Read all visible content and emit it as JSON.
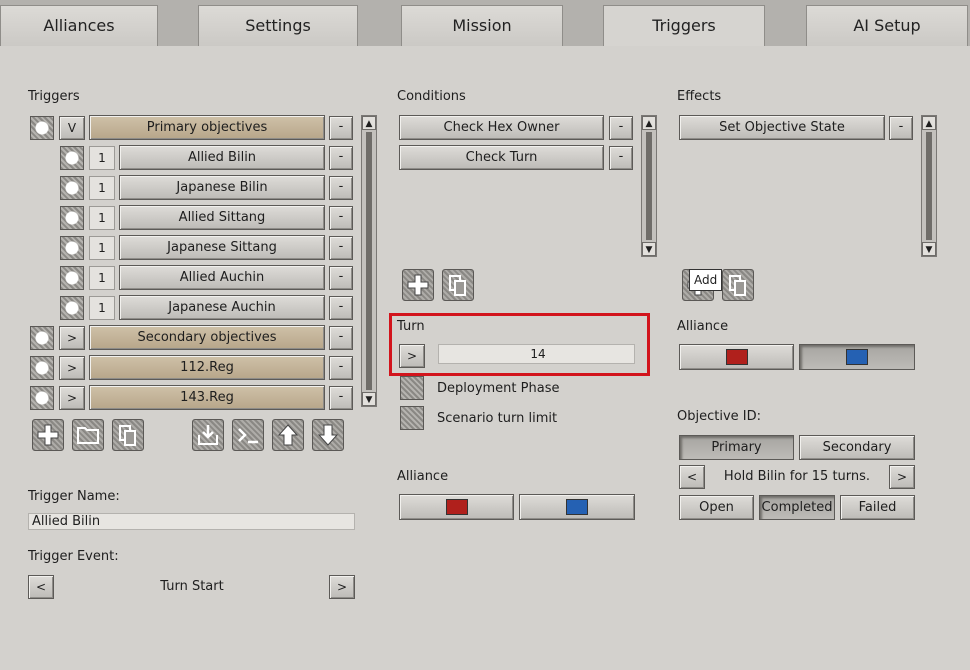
{
  "tabs": [
    "Alliances",
    "Settings",
    "Mission",
    "Triggers",
    "AI Setup"
  ],
  "triggers": {
    "heading": "Triggers",
    "rows": [
      {
        "toggle": "V",
        "label": "Primary objectives",
        "del": "-"
      },
      {
        "num": "1",
        "label": "Allied Bilin",
        "del": "-"
      },
      {
        "num": "1",
        "label": "Japanese Bilin",
        "del": "-"
      },
      {
        "num": "1",
        "label": "Allied Sittang",
        "del": "-"
      },
      {
        "num": "1",
        "label": "Japanese Sittang",
        "del": "-"
      },
      {
        "num": "1",
        "label": "Allied Auchin",
        "del": "-"
      },
      {
        "num": "1",
        "label": "Japanese Auchin",
        "del": "-"
      },
      {
        "toggle": ">",
        "label": "Secondary objectives",
        "del": "-"
      },
      {
        "toggle": ">",
        "label": "112.Reg",
        "del": "-"
      },
      {
        "toggle": ">",
        "label": "143.Reg",
        "del": "-"
      }
    ]
  },
  "trigger_name": {
    "label": "Trigger Name:",
    "value": "Allied Bilin"
  },
  "trigger_event": {
    "label": "Trigger Event:",
    "value": "Turn Start",
    "prev": "<",
    "next": ">"
  },
  "conditions": {
    "heading": "Conditions",
    "items": [
      {
        "label": "Check Hex Owner",
        "del": "-"
      },
      {
        "label": "Check Turn",
        "del": "-"
      }
    ]
  },
  "turn": {
    "label": "Turn",
    "toggle": ">",
    "value": "14"
  },
  "options": [
    "Deployment Phase",
    "Scenario turn limit"
  ],
  "alliance_mid": {
    "label": "Alliance"
  },
  "effects": {
    "heading": "Effects",
    "items": [
      {
        "label": "Set Objective State",
        "del": "-"
      }
    ],
    "tooltip": "Add"
  },
  "alliance_right": {
    "label": "Alliance"
  },
  "objective": {
    "label": "Objective ID:",
    "types": [
      "Primary",
      "Secondary"
    ],
    "prev": "<",
    "next": ">",
    "text": "Hold Bilin for 15 turns.",
    "states": [
      "Open",
      "Completed",
      "Failed"
    ]
  },
  "colors": {
    "red": "#b0201c",
    "blue": "#2561b3",
    "highlight": "#d2141c"
  }
}
